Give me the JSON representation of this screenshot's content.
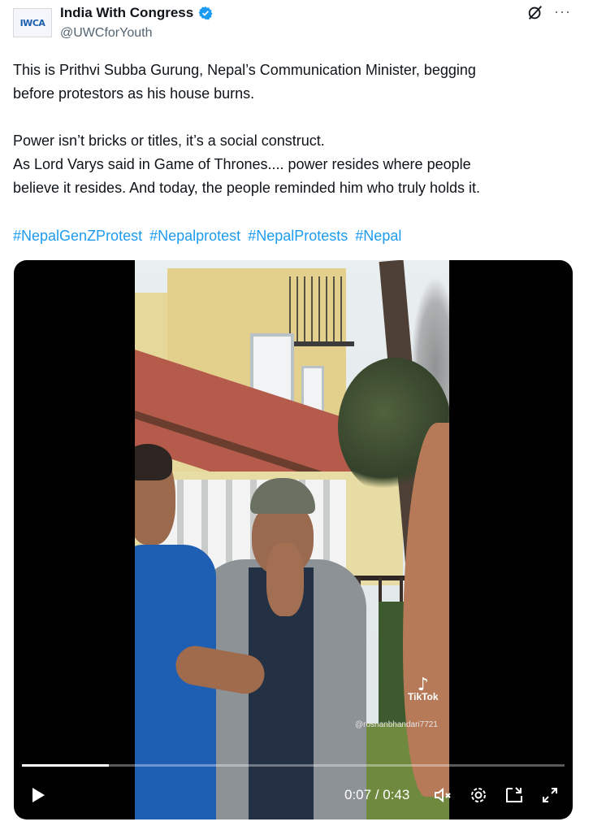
{
  "author": {
    "name": "India With Congress",
    "handle": "@UWCforYouth",
    "avatar_text": "IWCA",
    "verified_color": "#1d9bf0"
  },
  "tweet": {
    "line1": "This is Prithvi Subba Gurung, Nepal’s Communication Minister, begging",
    "line2": "before protestors as his house burns.",
    "line3": "Power isn’t bricks or titles, it’s a social construct.",
    "line4": "As Lord Varys said in Game of Thrones.... power resides where people",
    "line5": "believe it resides. And today, the people reminded him who truly holds it.",
    "hashtags": [
      "#NepalGenZProtest",
      "#Nepalprotest",
      "#NepalProtests",
      "#Nepal"
    ]
  },
  "video": {
    "watermark": "TikTok",
    "watermark_user": "@roshanbhandari7721",
    "time": "0:07 / 0:43",
    "progress_fraction": 0.16,
    "controls": [
      "play-icon",
      "mute-icon",
      "settings-icon",
      "pip-icon",
      "fullscreen-icon"
    ]
  },
  "icons": [
    "grok-icon",
    "more-icon",
    "verified-badge-icon"
  ]
}
